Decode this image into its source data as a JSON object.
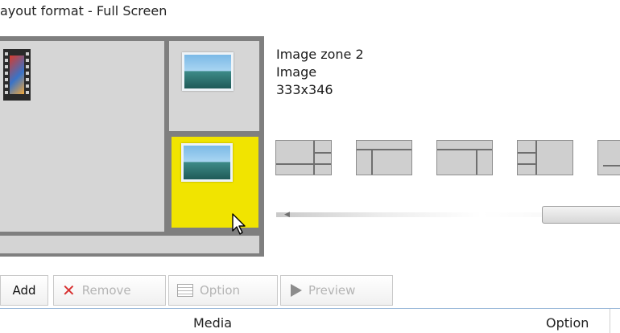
{
  "window": {
    "title": "ayout format - Full Screen"
  },
  "zone_info": {
    "name": "Image zone 2",
    "type": "Image",
    "size": "333x346"
  },
  "preview": {
    "selected_zone_color": "#f1e400",
    "icons": [
      "film-strip-icon",
      "image-icon",
      "image-icon"
    ]
  },
  "layout_options": [
    "layout-1",
    "layout-2",
    "layout-3",
    "layout-4",
    "layout-5"
  ],
  "toolbar": {
    "add_label": "Add",
    "remove_label": "Remove",
    "options_label": "Option",
    "preview_label": "Preview"
  },
  "table": {
    "columns": [
      "Media",
      "Option"
    ]
  }
}
